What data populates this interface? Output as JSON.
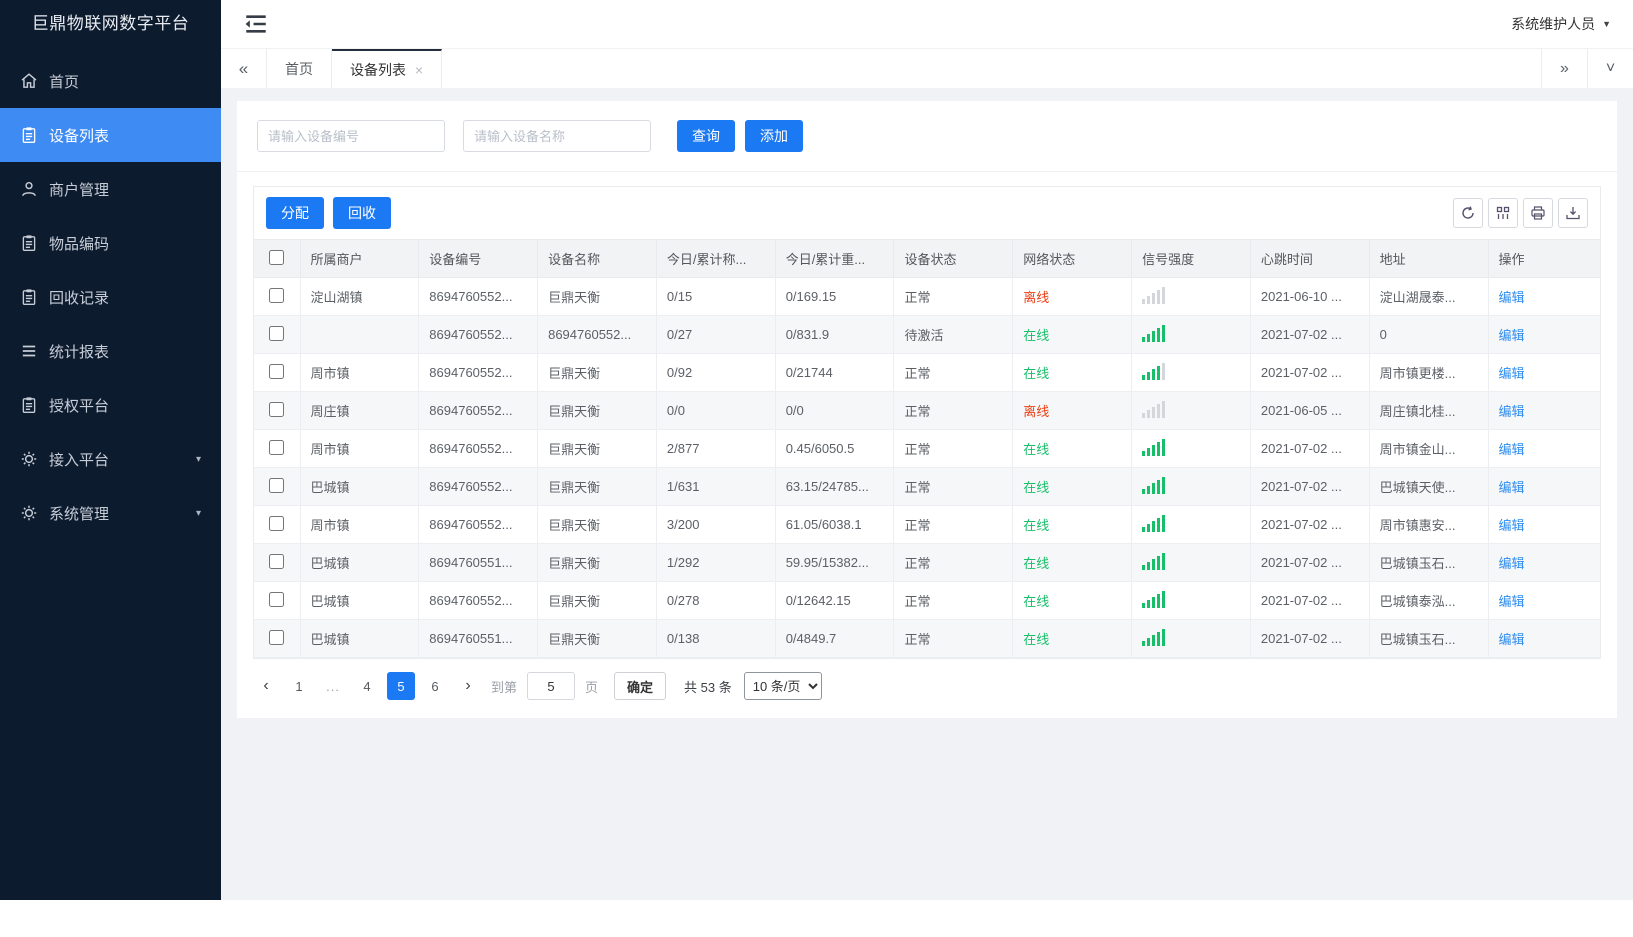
{
  "app": {
    "title": "巨鼎物联网数字平台",
    "user": "系统维护人员"
  },
  "sidebar": {
    "items": [
      {
        "key": "home",
        "label": "首页",
        "icon": "home-icon",
        "active": false,
        "arrow": false
      },
      {
        "key": "device-list",
        "label": "设备列表",
        "icon": "doc-icon",
        "active": true,
        "arrow": false
      },
      {
        "key": "merchant-mgmt",
        "label": "商户管理",
        "icon": "user-icon",
        "active": false,
        "arrow": false
      },
      {
        "key": "item-code",
        "label": "物品编码",
        "icon": "doc-icon",
        "active": false,
        "arrow": false
      },
      {
        "key": "recycle-records",
        "label": "回收记录",
        "icon": "doc-icon",
        "active": false,
        "arrow": false
      },
      {
        "key": "stats-report",
        "label": "统计报表",
        "icon": "menu-lines-icon",
        "active": false,
        "arrow": false
      },
      {
        "key": "auth-platform",
        "label": "授权平台",
        "icon": "doc-icon",
        "active": false,
        "arrow": false
      },
      {
        "key": "access-platform",
        "label": "接入平台",
        "icon": "gear-icon",
        "active": false,
        "arrow": true
      },
      {
        "key": "system-mgmt",
        "label": "系统管理",
        "icon": "gear-icon",
        "active": false,
        "arrow": true
      }
    ]
  },
  "tabs": {
    "items": [
      {
        "key": "home",
        "label": "首页",
        "active": false,
        "closable": false
      },
      {
        "key": "device-list",
        "label": "设备列表",
        "active": true,
        "closable": true
      }
    ]
  },
  "search": {
    "device_no_placeholder": "请输入设备编号",
    "device_name_placeholder": "请输入设备名称",
    "query_label": "查询",
    "add_label": "添加"
  },
  "toolbar": {
    "assign_label": "分配",
    "recycle_label": "回收",
    "icons": [
      "refresh-icon",
      "columns-icon",
      "print-icon",
      "export-icon"
    ]
  },
  "table": {
    "columns": [
      {
        "key": "merchant",
        "label": "所属商户"
      },
      {
        "key": "device_no",
        "label": "设备编号"
      },
      {
        "key": "device_name",
        "label": "设备名称"
      },
      {
        "key": "today_count",
        "label": "今日/累计称..."
      },
      {
        "key": "today_weight",
        "label": "今日/累计重..."
      },
      {
        "key": "device_status",
        "label": "设备状态"
      },
      {
        "key": "network_status",
        "label": "网络状态"
      },
      {
        "key": "signal",
        "label": "信号强度"
      },
      {
        "key": "heartbeat",
        "label": "心跳时间"
      },
      {
        "key": "address",
        "label": "地址"
      },
      {
        "key": "action",
        "label": "操作"
      }
    ],
    "rows": [
      {
        "merchant": "淀山湖镇",
        "device_no": "8694760552...",
        "device_name": "巨鼎天衡",
        "today_count": "0/15",
        "today_weight": "0/169.15",
        "device_status": "正常",
        "network_status": "离线",
        "network_online": false,
        "signal_level": 0,
        "heartbeat": "2021-06-10 ...",
        "address": "淀山湖晟泰...",
        "action": "编辑"
      },
      {
        "merchant": "",
        "device_no": "8694760552...",
        "device_name": "8694760552...",
        "today_count": "0/27",
        "today_weight": "0/831.9",
        "device_status": "待激活",
        "network_status": "在线",
        "network_online": true,
        "signal_level": 5,
        "heartbeat": "2021-07-02 ...",
        "address": "0",
        "action": "编辑"
      },
      {
        "merchant": "周市镇",
        "device_no": "8694760552...",
        "device_name": "巨鼎天衡",
        "today_count": "0/92",
        "today_weight": "0/21744",
        "device_status": "正常",
        "network_status": "在线",
        "network_online": true,
        "signal_level": 4,
        "heartbeat": "2021-07-02 ...",
        "address": "周市镇更楼...",
        "action": "编辑"
      },
      {
        "merchant": "周庄镇",
        "device_no": "8694760552...",
        "device_name": "巨鼎天衡",
        "today_count": "0/0",
        "today_weight": "0/0",
        "device_status": "正常",
        "network_status": "离线",
        "network_online": false,
        "signal_level": 0,
        "heartbeat": "2021-06-05 ...",
        "address": "周庄镇北桂...",
        "action": "编辑"
      },
      {
        "merchant": "周市镇",
        "device_no": "8694760552...",
        "device_name": "巨鼎天衡",
        "today_count": "2/877",
        "today_weight": "0.45/6050.5",
        "device_status": "正常",
        "network_status": "在线",
        "network_online": true,
        "signal_level": 5,
        "heartbeat": "2021-07-02 ...",
        "address": "周市镇金山...",
        "action": "编辑"
      },
      {
        "merchant": "巴城镇",
        "device_no": "8694760552...",
        "device_name": "巨鼎天衡",
        "today_count": "1/631",
        "today_weight": "63.15/24785...",
        "device_status": "正常",
        "network_status": "在线",
        "network_online": true,
        "signal_level": 5,
        "heartbeat": "2021-07-02 ...",
        "address": "巴城镇天使...",
        "action": "编辑"
      },
      {
        "merchant": "周市镇",
        "device_no": "8694760552...",
        "device_name": "巨鼎天衡",
        "today_count": "3/200",
        "today_weight": "61.05/6038.1",
        "device_status": "正常",
        "network_status": "在线",
        "network_online": true,
        "signal_level": 5,
        "heartbeat": "2021-07-02 ...",
        "address": "周市镇惠安...",
        "action": "编辑"
      },
      {
        "merchant": "巴城镇",
        "device_no": "8694760551...",
        "device_name": "巨鼎天衡",
        "today_count": "1/292",
        "today_weight": "59.95/15382...",
        "device_status": "正常",
        "network_status": "在线",
        "network_online": true,
        "signal_level": 5,
        "heartbeat": "2021-07-02 ...",
        "address": "巴城镇玉石...",
        "action": "编辑"
      },
      {
        "merchant": "巴城镇",
        "device_no": "8694760552...",
        "device_name": "巨鼎天衡",
        "today_count": "0/278",
        "today_weight": "0/12642.15",
        "device_status": "正常",
        "network_status": "在线",
        "network_online": true,
        "signal_level": 5,
        "heartbeat": "2021-07-02 ...",
        "address": "巴城镇泰泓...",
        "action": "编辑"
      },
      {
        "merchant": "巴城镇",
        "device_no": "8694760551...",
        "device_name": "巨鼎天衡",
        "today_count": "0/138",
        "today_weight": "0/4849.7",
        "device_status": "正常",
        "network_status": "在线",
        "network_online": true,
        "signal_level": 5,
        "heartbeat": "2021-07-02 ...",
        "address": "巴城镇玉石...",
        "action": "编辑"
      }
    ]
  },
  "pagination": {
    "pages": [
      {
        "label": "1",
        "active": false,
        "ellipsis": false
      },
      {
        "label": "...",
        "active": false,
        "ellipsis": true
      },
      {
        "label": "4",
        "active": false,
        "ellipsis": false
      },
      {
        "label": "5",
        "active": true,
        "ellipsis": false
      },
      {
        "label": "6",
        "active": false,
        "ellipsis": false
      }
    ],
    "goto_prefix": "到第",
    "goto_value": "5",
    "goto_suffix": "页",
    "confirm_label": "确定",
    "total_text": "共 53 条",
    "page_size": "10 条/页"
  },
  "colors": {
    "primary": "#1a79f3",
    "sidebar_bg": "#0d1b2f",
    "active_item": "#3e8bf4",
    "online_green": "#19be6b",
    "offline_red": "#ed3f14",
    "link_blue": "#2d8cf0"
  }
}
